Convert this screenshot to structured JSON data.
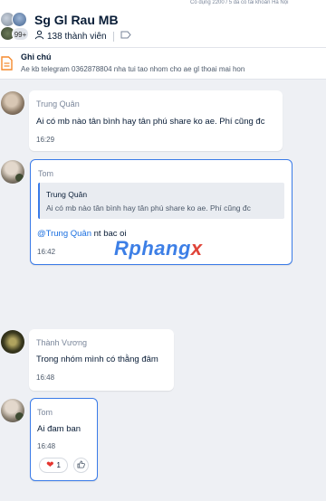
{
  "header": {
    "top_strip_text": "Có dụng 2200 / 5 đã có tài khoản Hà Nội",
    "group_title": "Sg Gl Rau MB",
    "member_count": "138 thành viên",
    "avatar_overflow": "99+"
  },
  "pinned_note": {
    "title": "Ghi chú",
    "text": "Ae kb telegram 0362878804 nha tui tao nhom cho ae gl thoai mai hon"
  },
  "messages": [
    {
      "sender": "Trung Quân",
      "text": "Ai có mb nào tân bình hay tân phú share ko ae. Phí cũng đc",
      "time": "16:29"
    },
    {
      "sender": "Tom",
      "quote_sender": "Trung Quân",
      "quote_text": "Ai có mb nào tân bình hay tân phú share ko ae. Phí cũng đc",
      "mention": "@Trung Quân",
      "text": " nt bac oi",
      "time": "16:42"
    },
    {
      "sender": "Thành Vương",
      "text": "Trong nhóm mình có thằng đâm",
      "time": "16:48"
    },
    {
      "sender": "Tom",
      "text": "Ai đam ban",
      "time": "16:48",
      "reaction_count": "1"
    }
  ],
  "watermark": {
    "part1": "Rphang",
    "part2": "x"
  },
  "colors": {
    "accent": "#3a7be8",
    "background": "#eef0f4",
    "note_icon": "#f58a2e",
    "heart": "#e5352f"
  },
  "icons": [
    "people-icon",
    "tag-icon",
    "note-icon",
    "heart-icon",
    "like-icon"
  ]
}
